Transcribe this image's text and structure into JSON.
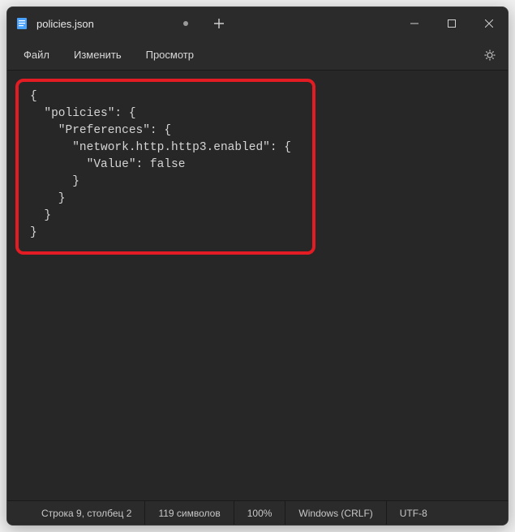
{
  "tab": {
    "title": "policies.json"
  },
  "menu": {
    "file": "Файл",
    "edit": "Изменить",
    "view": "Просмотр"
  },
  "editor": {
    "content": "{\n  \"policies\": {\n    \"Preferences\": {\n      \"network.http.http3.enabled\": {\n        \"Value\": false\n      }\n    }\n  }\n}"
  },
  "statusbar": {
    "position": "Строка 9, столбец 2",
    "chars": "119 символов",
    "zoom": "100%",
    "line_ending": "Windows (CRLF)",
    "encoding": "UTF-8"
  }
}
